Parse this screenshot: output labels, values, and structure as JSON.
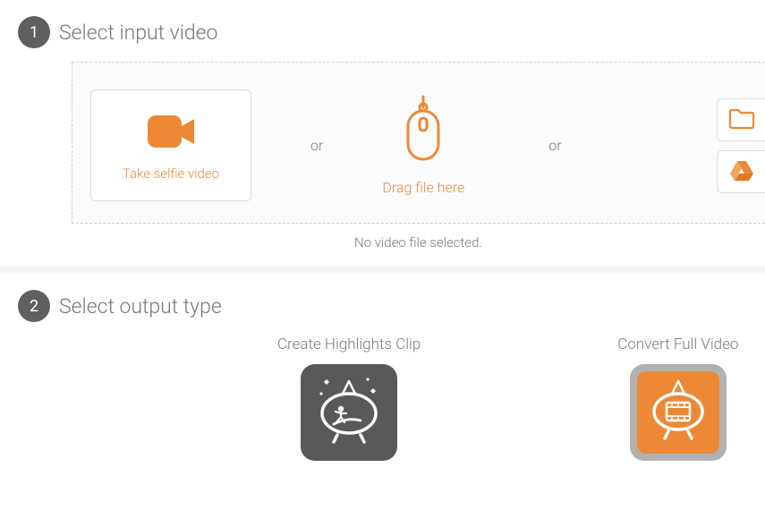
{
  "step1": {
    "number": "1",
    "title": "Select input video",
    "selfie_label": "Take selfie video",
    "or_text": "or",
    "drag_label": "Drag file here",
    "status": "No video file selected."
  },
  "step2": {
    "number": "2",
    "title": "Select output type",
    "options": [
      {
        "label": "Create Highlights Clip"
      },
      {
        "label": "Convert Full Video"
      }
    ]
  },
  "colors": {
    "accent": "#ed8936",
    "badge": "#5f5f5f"
  }
}
